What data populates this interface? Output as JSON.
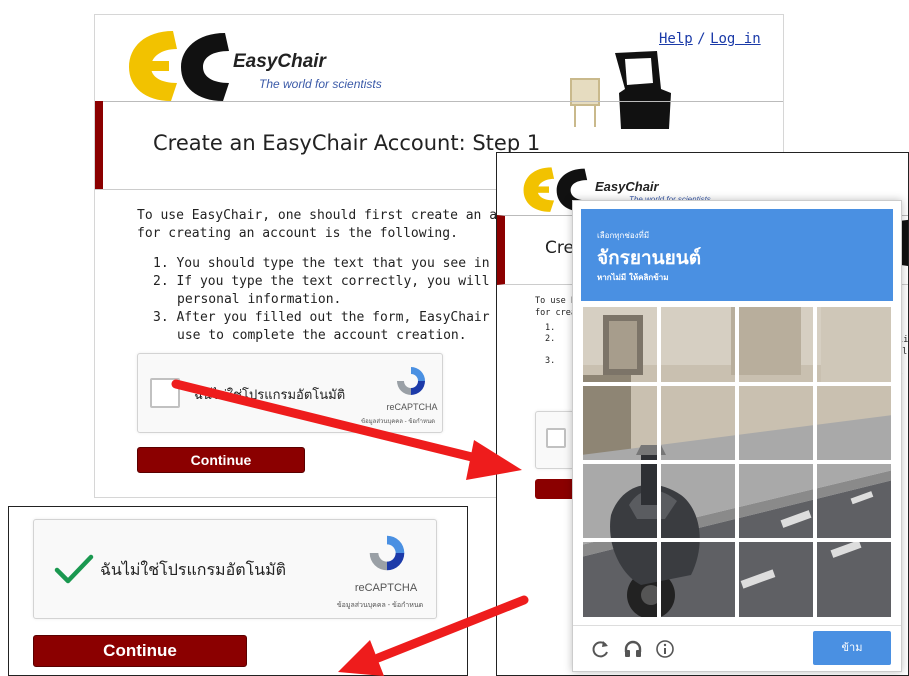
{
  "easychair": {
    "logo_name": "EasyChair",
    "logo_tagline": "The world for scientists",
    "help_link": "Help",
    "separator": "/",
    "login_link": "Log in",
    "page_title": "Create an EasyChair Account: Step 1",
    "page_title_partial": "Cre",
    "intro": "To use EasyChair, one should first create an account",
    "intro_line2": "for creating an account is the following.",
    "intro_partial": "To use E",
    "intro_partial2": "for crea",
    "steps": [
      "You should type the text that you see in the ir",
      "If you type the text correctly, you will be aske",
      "personal information.",
      "After you filled out the form, EasyChair will se",
      "use to complete the account creation."
    ],
    "step_numbers": [
      "1.",
      "2.",
      "3."
    ],
    "continue_label": "Continue",
    "colors": {
      "accent": "#8b0000",
      "link": "#1a3aa8"
    }
  },
  "recaptcha": {
    "label": "ฉันไม่ใช่โปรแกรมอัตโนมัติ",
    "brand": "reCAPTCHA",
    "privacy_terms": "ข้อมูลส่วนบุคคล - ข้อกำหนด",
    "checked_icon": "checkmark-icon",
    "logo_icon": "recaptcha-logo-icon"
  },
  "challenge": {
    "instruction": "เลือกทุกช่องที่มี",
    "target": "จักรยานยนต์",
    "hint": "หากไม่มี ให้คลิกข้าม",
    "skip_label": "ข้าม",
    "grid_rows": 4,
    "grid_cols": 4,
    "icons": [
      "reload-icon",
      "headphones-icon",
      "info-icon"
    ],
    "colors": {
      "header": "#4a90e2",
      "skip": "#4a90e2"
    }
  },
  "partial_right_text": [
    "tli",
    "pl",
    "w"
  ]
}
